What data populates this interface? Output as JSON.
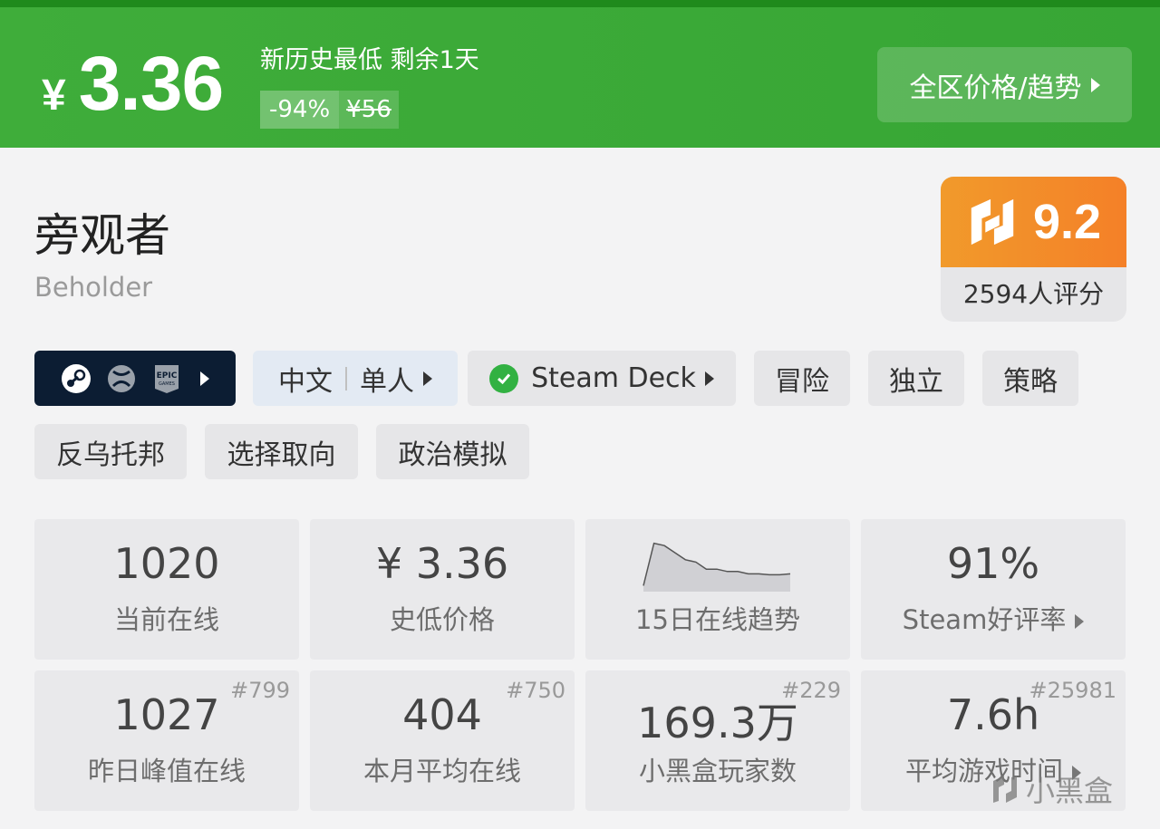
{
  "banner": {
    "currency": "¥",
    "price": "3.36",
    "promo_text": "新历史最低 剩余1天",
    "discount": "-94%",
    "original_price": "¥56",
    "region_button": "全区价格/趋势"
  },
  "game": {
    "title_cn": "旁观者",
    "title_en": "Beholder",
    "score": "9.2",
    "rating_count": "2594人评分"
  },
  "tags": {
    "language": "中文",
    "mode": "单人",
    "steam_deck": "Steam Deck",
    "genre": [
      "冒险",
      "独立",
      "策略",
      "反乌托邦",
      "选择取向",
      "政治模拟"
    ]
  },
  "stats": {
    "current_online": {
      "value": "1020",
      "label": "当前在线"
    },
    "lowest_price": {
      "value": "¥ 3.36",
      "label": "史低价格"
    },
    "trend": {
      "label": "15日在线趋势",
      "series": [
        0.05,
        0.95,
        0.9,
        0.75,
        0.6,
        0.55,
        0.4,
        0.4,
        0.35,
        0.35,
        0.3,
        0.3,
        0.28,
        0.28,
        0.3
      ]
    },
    "steam_rating": {
      "value": "91%",
      "label": "Steam好评率"
    },
    "yesterday_peak": {
      "value": "1027",
      "label": "昨日峰值在线",
      "rank": "#799"
    },
    "month_avg": {
      "value": "404",
      "label": "本月平均在线",
      "rank": "#750"
    },
    "players": {
      "value": "169.3万",
      "label": "小黑盒玩家数",
      "rank": "#229"
    },
    "avg_playtime": {
      "value": "7.6h",
      "label": "平均游戏时间",
      "rank": "#25981"
    }
  },
  "watermark": "小黑盒",
  "colors": {
    "banner": "#3fad3a",
    "score": "#f48028",
    "platform": "#0c1d33",
    "check": "#32b142"
  }
}
